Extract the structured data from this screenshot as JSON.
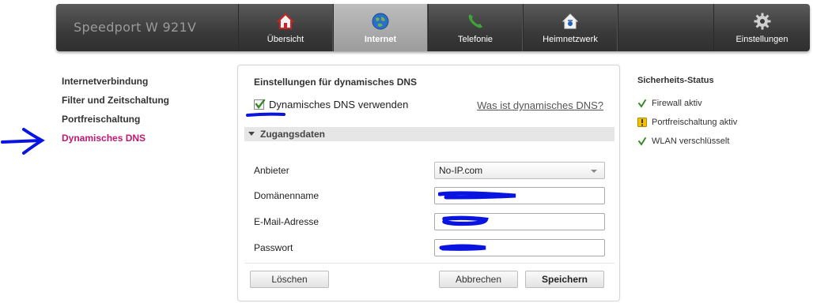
{
  "brand": "Speedport W 921V",
  "nav": [
    {
      "label": "Übersicht",
      "icon": "home-icon"
    },
    {
      "label": "Internet",
      "icon": "globe-icon",
      "active": true
    },
    {
      "label": "Telefonie",
      "icon": "phone-icon"
    },
    {
      "label": "Heimnetzwerk",
      "icon": "home-network-icon"
    },
    {
      "label": "Einstellungen",
      "icon": "gear-icon"
    }
  ],
  "subnav": [
    {
      "label": "Internetverbindung"
    },
    {
      "label": "Filter und Zeitschaltung"
    },
    {
      "label": "Portfreischaltung"
    },
    {
      "label": "Dynamisches DNS",
      "active": true
    }
  ],
  "panel": {
    "title": "Einstellungen für dynamisches DNS",
    "checkbox_label": "Dynamisches DNS verwenden",
    "checkbox_checked": true,
    "help_link": "Was ist dynamisches DNS?",
    "section": "Zugangsdaten",
    "fields": {
      "provider_label": "Anbieter",
      "provider_value": "No-IP.com",
      "domain_label": "Domänenname",
      "email_label": "E-Mail-Adresse",
      "password_label": "Passwort"
    },
    "buttons": {
      "delete": "Löschen",
      "cancel": "Abbrechen",
      "save": "Speichern"
    }
  },
  "status": {
    "title": "Sicherheits-Status",
    "items": [
      {
        "label": "Firewall aktiv",
        "state": "ok"
      },
      {
        "label": "Portfreischaltung aktiv",
        "state": "warning"
      },
      {
        "label": "WLAN verschlüsselt",
        "state": "ok"
      }
    ]
  },
  "colors": {
    "accent": "#c0186e",
    "annotation": "#0a14e0",
    "ok": "#3a8a2a",
    "warning": "#e0b000"
  }
}
